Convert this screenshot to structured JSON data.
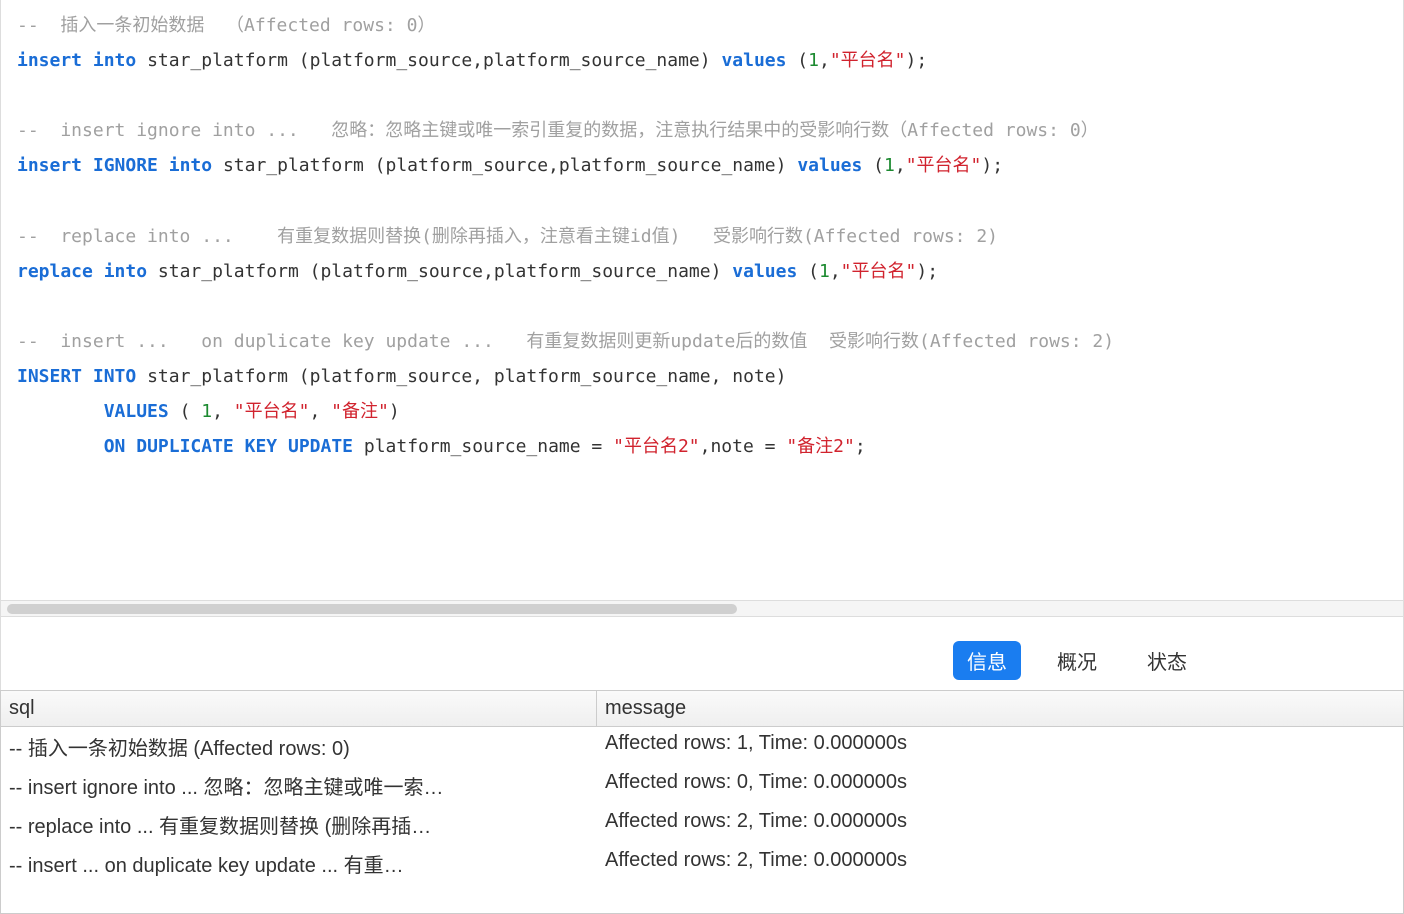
{
  "editor": {
    "lines": [
      [
        {
          "cls": "comment",
          "t": "--  插入一条初始数据  （Affected rows: 0）"
        }
      ],
      [
        {
          "cls": "keyword",
          "t": "insert"
        },
        {
          "cls": "plain",
          "t": " "
        },
        {
          "cls": "keyword",
          "t": "into"
        },
        {
          "cls": "plain",
          "t": " star_platform (platform_source,platform_source_name) "
        },
        {
          "cls": "keyword",
          "t": "values"
        },
        {
          "cls": "plain",
          "t": " ("
        },
        {
          "cls": "number",
          "t": "1"
        },
        {
          "cls": "plain",
          "t": ","
        },
        {
          "cls": "string",
          "t": "\"平台名\""
        },
        {
          "cls": "plain",
          "t": ");"
        }
      ],
      [
        {
          "cls": "plain",
          "t": ""
        }
      ],
      [
        {
          "cls": "comment",
          "t": "--  insert ignore into ...   忽略：忽略主键或唯一索引重复的数据，注意执行结果中的受影响行数（Affected rows: 0）"
        }
      ],
      [
        {
          "cls": "keyword",
          "t": "insert"
        },
        {
          "cls": "plain",
          "t": " "
        },
        {
          "cls": "keyword",
          "t": "IGNORE"
        },
        {
          "cls": "plain",
          "t": " "
        },
        {
          "cls": "keyword",
          "t": "into"
        },
        {
          "cls": "plain",
          "t": " star_platform (platform_source,platform_source_name) "
        },
        {
          "cls": "keyword",
          "t": "values"
        },
        {
          "cls": "plain",
          "t": " ("
        },
        {
          "cls": "number",
          "t": "1"
        },
        {
          "cls": "plain",
          "t": ","
        },
        {
          "cls": "string",
          "t": "\"平台名\""
        },
        {
          "cls": "plain",
          "t": ");"
        }
      ],
      [
        {
          "cls": "plain",
          "t": ""
        }
      ],
      [
        {
          "cls": "comment",
          "t": "--  replace into ...    有重复数据则替换(删除再插入，注意看主键id值)   受影响行数(Affected rows: 2)"
        }
      ],
      [
        {
          "cls": "keyword",
          "t": "replace"
        },
        {
          "cls": "plain",
          "t": " "
        },
        {
          "cls": "keyword",
          "t": "into"
        },
        {
          "cls": "plain",
          "t": " star_platform (platform_source,platform_source_name) "
        },
        {
          "cls": "keyword",
          "t": "values"
        },
        {
          "cls": "plain",
          "t": " ("
        },
        {
          "cls": "number",
          "t": "1"
        },
        {
          "cls": "plain",
          "t": ","
        },
        {
          "cls": "string",
          "t": "\"平台名\""
        },
        {
          "cls": "plain",
          "t": ");"
        }
      ],
      [
        {
          "cls": "plain",
          "t": ""
        }
      ],
      [
        {
          "cls": "comment",
          "t": "--  insert ...   on duplicate key update ...   有重复数据则更新update后的数值  受影响行数(Affected rows: 2)"
        }
      ],
      [
        {
          "cls": "keyword",
          "t": "INSERT"
        },
        {
          "cls": "plain",
          "t": " "
        },
        {
          "cls": "keyword",
          "t": "INTO"
        },
        {
          "cls": "plain",
          "t": " star_platform (platform_source, platform_source_name, note)"
        }
      ],
      [
        {
          "cls": "plain",
          "t": "        "
        },
        {
          "cls": "keyword",
          "t": "VALUES"
        },
        {
          "cls": "plain",
          "t": " ( "
        },
        {
          "cls": "number",
          "t": "1"
        },
        {
          "cls": "plain",
          "t": ", "
        },
        {
          "cls": "string",
          "t": "\"平台名\""
        },
        {
          "cls": "plain",
          "t": ", "
        },
        {
          "cls": "string",
          "t": "\"备注\""
        },
        {
          "cls": "plain",
          "t": ")"
        }
      ],
      [
        {
          "cls": "plain",
          "t": "        "
        },
        {
          "cls": "keyword",
          "t": "ON"
        },
        {
          "cls": "plain",
          "t": " "
        },
        {
          "cls": "keyword",
          "t": "DUPLICATE"
        },
        {
          "cls": "plain",
          "t": " "
        },
        {
          "cls": "keyword",
          "t": "KEY"
        },
        {
          "cls": "plain",
          "t": " "
        },
        {
          "cls": "keyword",
          "t": "UPDATE"
        },
        {
          "cls": "plain",
          "t": " platform_source_name = "
        },
        {
          "cls": "string",
          "t": "\"平台名2\""
        },
        {
          "cls": "plain",
          "t": ",note = "
        },
        {
          "cls": "string",
          "t": "\"备注2\""
        },
        {
          "cls": "plain",
          "t": ";"
        }
      ]
    ]
  },
  "tabs": {
    "items": [
      {
        "label": "信息",
        "active": true
      },
      {
        "label": "概况",
        "active": false
      },
      {
        "label": "状态",
        "active": false
      }
    ]
  },
  "results": {
    "headers": {
      "sql": "sql",
      "message": "message"
    },
    "rows": [
      {
        "sql": "-- 插入一条初始数据  (Affected rows: 0)",
        "message": "Affected rows: 1, Time: 0.000000s"
      },
      {
        "sql": "-- insert ignore into ...  忽略：忽略主键或唯一索…",
        "message": "Affected rows: 0, Time: 0.000000s"
      },
      {
        "sql": "-- replace into ...    有重复数据则替换 (删除再插…",
        "message": "Affected rows: 2, Time: 0.000000s"
      },
      {
        "sql": "-- insert ...   on duplicate key update ...  有重…",
        "message": "Affected rows: 2, Time: 0.000000s"
      }
    ]
  }
}
